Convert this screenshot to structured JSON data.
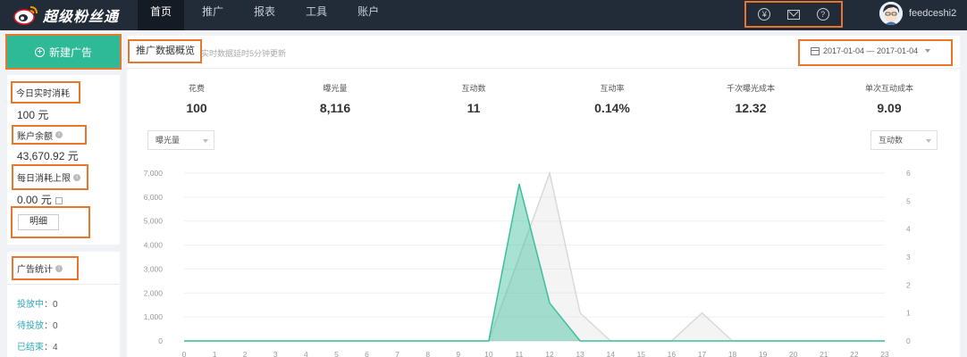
{
  "topbar": {
    "app_name": "超级粉丝通",
    "nav": [
      {
        "label": "首页",
        "active": true
      },
      {
        "label": "推广",
        "active": false
      },
      {
        "label": "报表",
        "active": false
      },
      {
        "label": "工具",
        "active": false
      },
      {
        "label": "账户",
        "active": false
      }
    ],
    "icons": [
      "yen-icon",
      "mail-icon",
      "help-icon"
    ],
    "username": "feedceshi2"
  },
  "sidebar": {
    "new_ad_label": "新建广告",
    "today_spend_label": "今日实时消耗",
    "today_spend_value": "100 元",
    "balance_label": "账户余额",
    "balance_value": "43,670.92 元",
    "daily_limit_label": "每日消耗上限",
    "daily_limit_value": "0.00 元",
    "detail_button": "明细",
    "ad_stats_label": "广告统计",
    "stats": [
      {
        "label": "投放中",
        "value": "0"
      },
      {
        "label": "待投放",
        "value": "0"
      },
      {
        "label": "已结束",
        "value": "4"
      }
    ]
  },
  "main": {
    "title": "推广数据概览",
    "note": "实时数据延时5分钟更新",
    "date_range": "2017-01-04 — 2017-01-04",
    "metrics": [
      {
        "label": "花费",
        "value": "100"
      },
      {
        "label": "曝光量",
        "value": "8,116"
      },
      {
        "label": "互动数",
        "value": "11"
      },
      {
        "label": "互动率",
        "value": "0.14%"
      },
      {
        "label": "千次曝光成本",
        "value": "12.32"
      },
      {
        "label": "单次互动成本",
        "value": "9.09"
      }
    ],
    "left_select": "曝光量",
    "right_select": "互动数"
  },
  "colors": {
    "accent": "#2fba97",
    "topbar": "#222b38",
    "highlight": "#e8772e"
  },
  "chart_data": {
    "type": "area",
    "x": [
      "0",
      "1",
      "2",
      "3",
      "4",
      "5",
      "6",
      "7",
      "8",
      "9",
      "10",
      "11",
      "12",
      "13",
      "14",
      "15",
      "16",
      "17",
      "18",
      "19",
      "20",
      "21",
      "22",
      "23"
    ],
    "y_left_ticks": [
      "0",
      "1,000",
      "2,000",
      "3,000",
      "4,000",
      "5,000",
      "6,000",
      "7,000"
    ],
    "y_right_ticks": [
      "0",
      "1",
      "2",
      "3",
      "4",
      "5",
      "6"
    ],
    "ylim_left": [
      0,
      7000
    ],
    "ylim_right": [
      0,
      6
    ],
    "series": [
      {
        "axis": "left",
        "color": "#3cbf9c",
        "values": [
          0,
          0,
          0,
          0,
          0,
          0,
          0,
          0,
          0,
          0,
          0,
          6550,
          1580,
          0,
          0,
          0,
          0,
          0,
          0,
          0,
          0,
          0,
          0,
          0
        ]
      },
      {
        "axis": "right",
        "color": "#d9d9d9",
        "values": [
          0,
          0,
          0,
          0,
          0,
          0,
          0,
          0,
          0,
          0,
          0,
          3,
          6,
          1,
          0,
          0,
          0,
          1,
          0,
          0,
          0,
          0,
          0,
          0
        ]
      }
    ],
    "grid": true
  }
}
